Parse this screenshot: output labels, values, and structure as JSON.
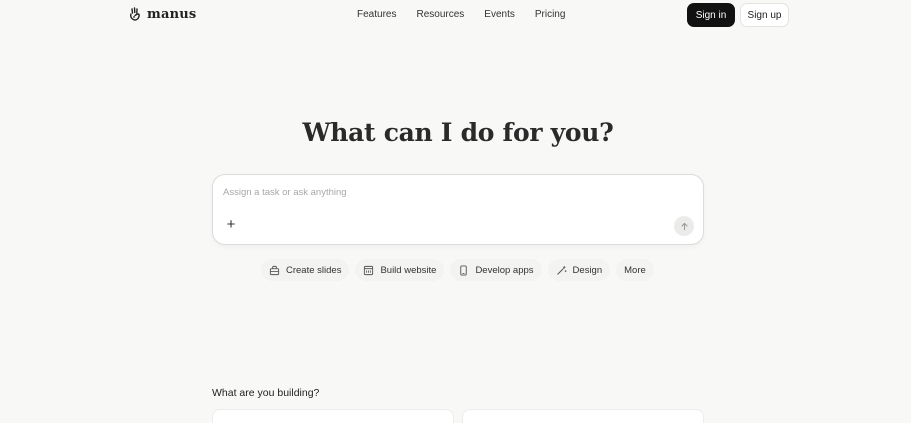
{
  "header": {
    "brand": "manus",
    "nav": [
      "Features",
      "Resources",
      "Events",
      "Pricing"
    ],
    "sign_in": "Sign in",
    "sign_up": "Sign up"
  },
  "hero": {
    "title": "What can I do for you?"
  },
  "prompt": {
    "placeholder": "Assign a task or ask anything",
    "value": "",
    "plus_icon": "plus-icon",
    "send_icon": "arrow-up-icon"
  },
  "chips": [
    {
      "label": "Create slides",
      "icon": "slides-icon"
    },
    {
      "label": "Build website",
      "icon": "website-icon"
    },
    {
      "label": "Develop apps",
      "icon": "phone-icon"
    },
    {
      "label": "Design",
      "icon": "design-wand-icon"
    },
    {
      "label": "More",
      "icon": ""
    }
  ],
  "section": {
    "title": "What are you building?"
  }
}
